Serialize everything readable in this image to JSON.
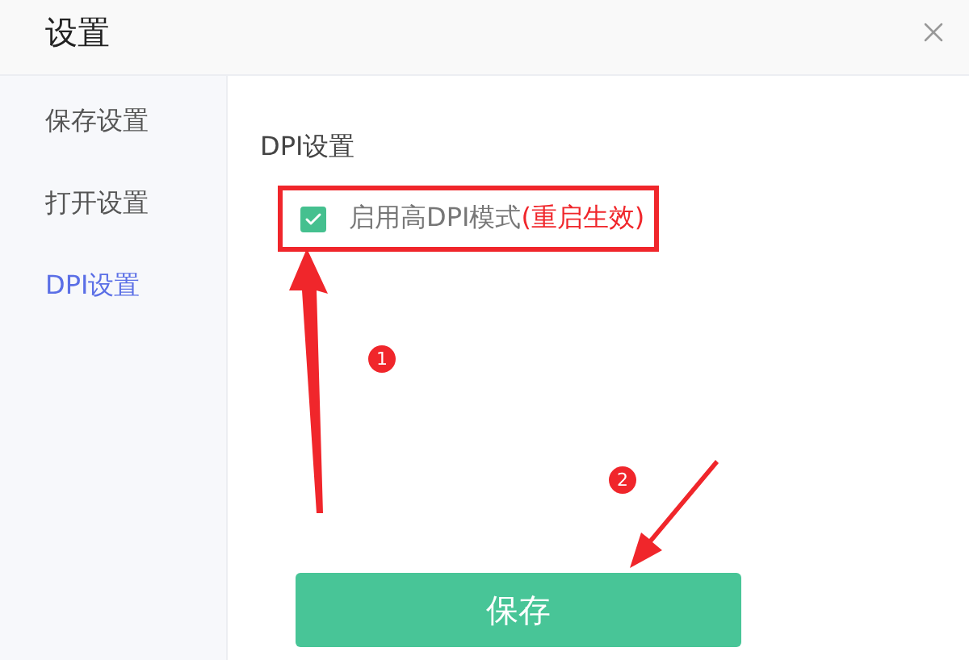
{
  "window": {
    "title": "设置"
  },
  "sidebar": {
    "items": [
      {
        "label": "保存设置",
        "selected": false
      },
      {
        "label": "打开设置",
        "selected": false
      },
      {
        "label": "DPI设置",
        "selected": true
      }
    ]
  },
  "section": {
    "title": "DPI设置"
  },
  "option": {
    "label": "启用高DPI模式",
    "note": "(重启生效)",
    "checked": true,
    "highlighted": true
  },
  "save_button": {
    "label": "保存"
  },
  "annotations": [
    {
      "number": "1"
    },
    {
      "number": "2"
    }
  ]
}
